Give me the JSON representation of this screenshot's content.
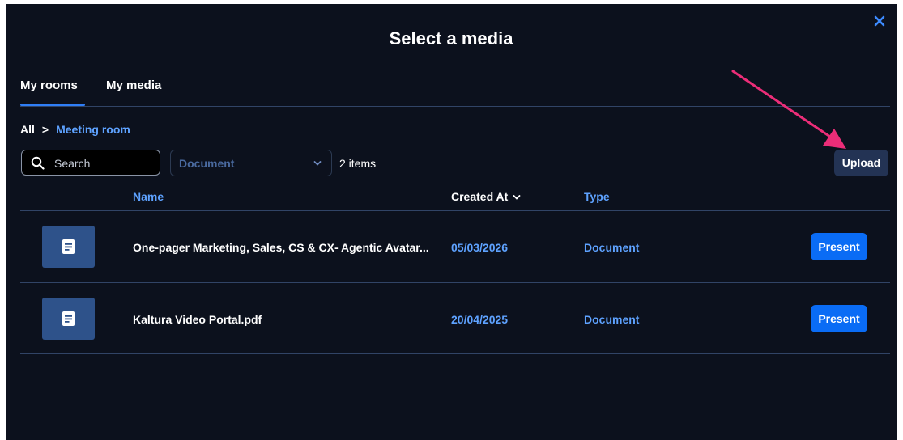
{
  "dialog": {
    "title": "Select a media",
    "close_icon": "close-icon"
  },
  "tabs": [
    {
      "label": "My rooms",
      "active": true
    },
    {
      "label": "My media",
      "active": false
    }
  ],
  "breadcrumb": {
    "root": "All",
    "separator": ">",
    "current": "Meeting room"
  },
  "toolbar": {
    "search_placeholder": "Search",
    "filter_value": "Document",
    "item_count": "2 items",
    "upload_label": "Upload"
  },
  "table": {
    "columns": {
      "name": "Name",
      "created_at": "Created At",
      "type": "Type"
    },
    "sort_icon": "chevron-down-icon",
    "rows": [
      {
        "name": "One-pager Marketing, Sales, CS & CX- Agentic Avatar...",
        "created_at": "05/03/2026",
        "type": "Document",
        "action": "Present",
        "icon": "document-icon"
      },
      {
        "name": "Kaltura Video Portal.pdf",
        "created_at": "20/04/2025",
        "type": "Document",
        "action": "Present",
        "icon": "document-icon"
      }
    ]
  },
  "colors": {
    "background": "#0c111d",
    "accent": "#0a6cf5",
    "link": "#5ea2ff",
    "annotation_arrow": "#ec2d78"
  }
}
